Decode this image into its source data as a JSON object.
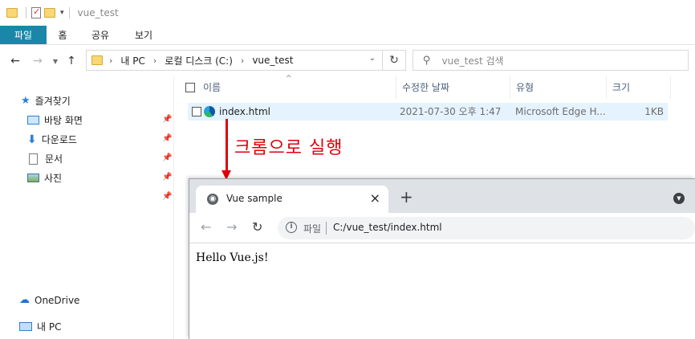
{
  "explorer": {
    "title": "vue_test",
    "ribbon": {
      "file": "파일",
      "home": "홈",
      "share": "공유",
      "view": "보기"
    },
    "address": {
      "pc": "내 PC",
      "drive": "로컬 디스크 (C:)",
      "folder": "vue_test"
    },
    "search_placeholder": "vue_test 검색",
    "sidebar": {
      "quick_access": "즐겨찾기",
      "items": [
        {
          "label": "바탕 화면",
          "icon": "desktop-icon"
        },
        {
          "label": "다운로드",
          "icon": "download-icon"
        },
        {
          "label": "문서",
          "icon": "document-icon"
        },
        {
          "label": "사진",
          "icon": "pictures-icon"
        }
      ],
      "onedrive": "OneDrive",
      "this_pc": "내 PC"
    },
    "columns": {
      "name": "이름",
      "modified": "수정한 날짜",
      "type": "유형",
      "size": "크기"
    },
    "files": [
      {
        "name": "index.html",
        "modified": "2021-07-30 오후 1:47",
        "type": "Microsoft Edge H...",
        "size": "1KB"
      }
    ]
  },
  "annotation": {
    "text": "크롬으로 실행",
    "color": "#e0000b"
  },
  "browser": {
    "tab_title": "Vue sample",
    "scheme_label": "파일",
    "url": "C:/vue_test/index.html",
    "page_text": "Hello Vue.js!"
  },
  "colors": {
    "file_tab": "#1a87a8",
    "selection": "#e5f3ff"
  }
}
